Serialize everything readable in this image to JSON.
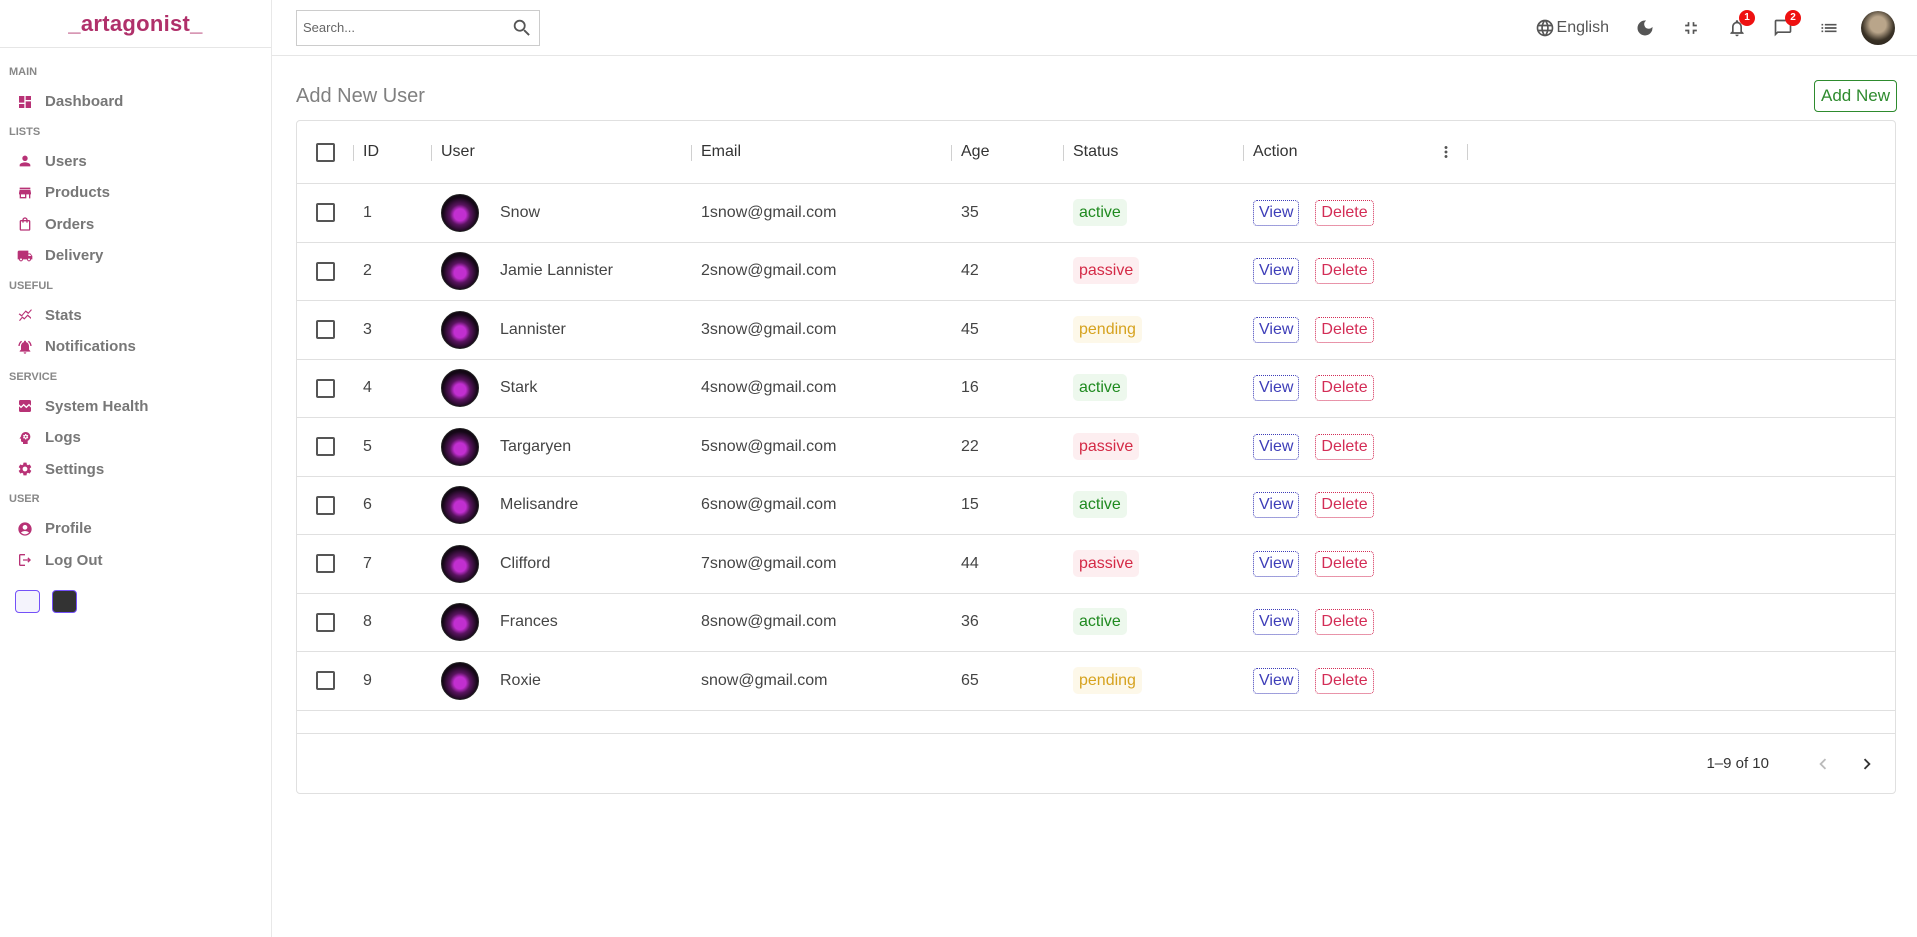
{
  "brand": {
    "logo": "_artagonist_",
    "accent": "#b83276"
  },
  "sidebar": {
    "sections": [
      {
        "title": "MAIN",
        "items": [
          {
            "label": "Dashboard",
            "icon": "dashboard-icon"
          }
        ]
      },
      {
        "title": "LISTS",
        "items": [
          {
            "label": "Users",
            "icon": "person-icon"
          },
          {
            "label": "Products",
            "icon": "store-icon"
          },
          {
            "label": "Orders",
            "icon": "bag-icon"
          },
          {
            "label": "Delivery",
            "icon": "truck-icon"
          }
        ]
      },
      {
        "title": "USEFUL",
        "items": [
          {
            "label": "Stats",
            "icon": "chart-icon"
          },
          {
            "label": "Notifications",
            "icon": "bell-icon"
          }
        ]
      },
      {
        "title": "SERVICE",
        "items": [
          {
            "label": "System Health",
            "icon": "health-icon"
          },
          {
            "label": "Logs",
            "icon": "psychology-icon"
          },
          {
            "label": "Settings",
            "icon": "gear-icon"
          }
        ]
      },
      {
        "title": "USER",
        "items": [
          {
            "label": "Profile",
            "icon": "account-circle-icon"
          },
          {
            "label": "Log Out",
            "icon": "logout-icon"
          }
        ]
      }
    ],
    "theme_options": [
      "light",
      "dark"
    ]
  },
  "topbar": {
    "search_placeholder": "Search...",
    "language": "English",
    "notifications_count": "1",
    "messages_count": "2"
  },
  "page": {
    "title": "Add New User",
    "add_button": "Add New"
  },
  "table": {
    "columns": {
      "id": "ID",
      "user": "User",
      "email": "Email",
      "age": "Age",
      "status": "Status",
      "action": "Action"
    },
    "view_label": "View",
    "delete_label": "Delete",
    "rows": [
      {
        "id": "1",
        "user": "Snow",
        "email": "1snow@gmail.com",
        "age": "35",
        "status": "active"
      },
      {
        "id": "2",
        "user": "Jamie Lannister",
        "email": "2snow@gmail.com",
        "age": "42",
        "status": "passive"
      },
      {
        "id": "3",
        "user": "Lannister",
        "email": "3snow@gmail.com",
        "age": "45",
        "status": "pending"
      },
      {
        "id": "4",
        "user": "Stark",
        "email": "4snow@gmail.com",
        "age": "16",
        "status": "active"
      },
      {
        "id": "5",
        "user": "Targaryen",
        "email": "5snow@gmail.com",
        "age": "22",
        "status": "passive"
      },
      {
        "id": "6",
        "user": "Melisandre",
        "email": "6snow@gmail.com",
        "age": "15",
        "status": "active"
      },
      {
        "id": "7",
        "user": "Clifford",
        "email": "7snow@gmail.com",
        "age": "44",
        "status": "passive"
      },
      {
        "id": "8",
        "user": "Frances",
        "email": "8snow@gmail.com",
        "age": "36",
        "status": "active"
      },
      {
        "id": "9",
        "user": "Roxie",
        "email": "snow@gmail.com",
        "age": "65",
        "status": "pending"
      }
    ],
    "pagination": "1–9 of 10"
  }
}
